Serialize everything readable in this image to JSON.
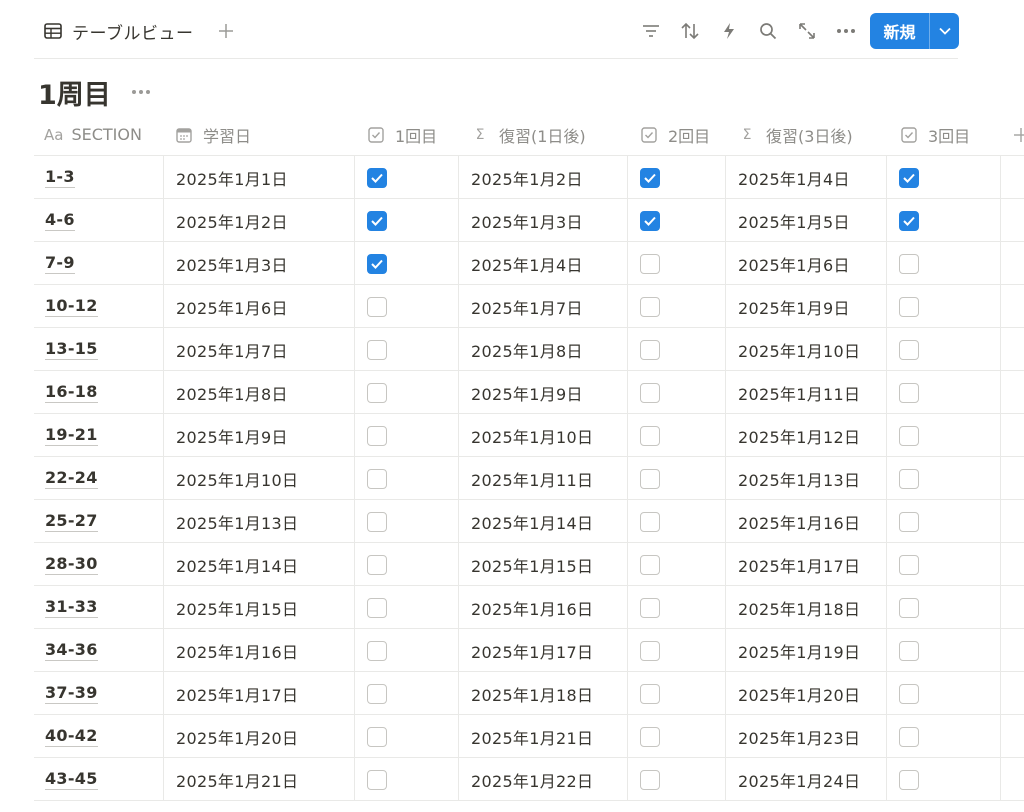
{
  "toolbar": {
    "view_tab_label": "テーブルビュー",
    "new_button_label": "新規",
    "accent_color": "#2383e2",
    "icons": [
      "filter-icon",
      "sort-icon",
      "automation-bolt-icon",
      "search-icon",
      "expand-icon",
      "more-icon"
    ]
  },
  "page": {
    "title": "1周目"
  },
  "columns": {
    "section": {
      "icon": "Aa",
      "label": "SECTION"
    },
    "study_date": {
      "icon": "calendar-icon",
      "label": "学習日"
    },
    "round1": {
      "icon": "checkbox-icon",
      "label": "1回目"
    },
    "review1": {
      "icon": "Σ",
      "label": "復習(1日後)"
    },
    "round2": {
      "icon": "checkbox-icon",
      "label": "2回目"
    },
    "review3": {
      "icon": "Σ",
      "label": "復習(3日後)"
    },
    "round3": {
      "icon": "checkbox-icon",
      "label": "3回目"
    }
  },
  "rows": [
    {
      "section": "1-3",
      "study_date": "2025年1月1日",
      "round1": true,
      "review1": "2025年1月2日",
      "round2": true,
      "review3": "2025年1月4日",
      "round3": true
    },
    {
      "section": "4-6",
      "study_date": "2025年1月2日",
      "round1": true,
      "review1": "2025年1月3日",
      "round2": true,
      "review3": "2025年1月5日",
      "round3": true
    },
    {
      "section": "7-9",
      "study_date": "2025年1月3日",
      "round1": true,
      "review1": "2025年1月4日",
      "round2": false,
      "review3": "2025年1月6日",
      "round3": false
    },
    {
      "section": "10-12",
      "study_date": "2025年1月6日",
      "round1": false,
      "review1": "2025年1月7日",
      "round2": false,
      "review3": "2025年1月9日",
      "round3": false
    },
    {
      "section": "13-15",
      "study_date": "2025年1月7日",
      "round1": false,
      "review1": "2025年1月8日",
      "round2": false,
      "review3": "2025年1月10日",
      "round3": false
    },
    {
      "section": "16-18",
      "study_date": "2025年1月8日",
      "round1": false,
      "review1": "2025年1月9日",
      "round2": false,
      "review3": "2025年1月11日",
      "round3": false
    },
    {
      "section": "19-21",
      "study_date": "2025年1月9日",
      "round1": false,
      "review1": "2025年1月10日",
      "round2": false,
      "review3": "2025年1月12日",
      "round3": false
    },
    {
      "section": "22-24",
      "study_date": "2025年1月10日",
      "round1": false,
      "review1": "2025年1月11日",
      "round2": false,
      "review3": "2025年1月13日",
      "round3": false
    },
    {
      "section": "25-27",
      "study_date": "2025年1月13日",
      "round1": false,
      "review1": "2025年1月14日",
      "round2": false,
      "review3": "2025年1月16日",
      "round3": false
    },
    {
      "section": "28-30",
      "study_date": "2025年1月14日",
      "round1": false,
      "review1": "2025年1月15日",
      "round2": false,
      "review3": "2025年1月17日",
      "round3": false
    },
    {
      "section": "31-33",
      "study_date": "2025年1月15日",
      "round1": false,
      "review1": "2025年1月16日",
      "round2": false,
      "review3": "2025年1月18日",
      "round3": false
    },
    {
      "section": "34-36",
      "study_date": "2025年1月16日",
      "round1": false,
      "review1": "2025年1月17日",
      "round2": false,
      "review3": "2025年1月19日",
      "round3": false
    },
    {
      "section": "37-39",
      "study_date": "2025年1月17日",
      "round1": false,
      "review1": "2025年1月18日",
      "round2": false,
      "review3": "2025年1月20日",
      "round3": false
    },
    {
      "section": "40-42",
      "study_date": "2025年1月20日",
      "round1": false,
      "review1": "2025年1月21日",
      "round2": false,
      "review3": "2025年1月23日",
      "round3": false
    },
    {
      "section": "43-45",
      "study_date": "2025年1月21日",
      "round1": false,
      "review1": "2025年1月22日",
      "round2": false,
      "review3": "2025年1月24日",
      "round3": false
    }
  ]
}
